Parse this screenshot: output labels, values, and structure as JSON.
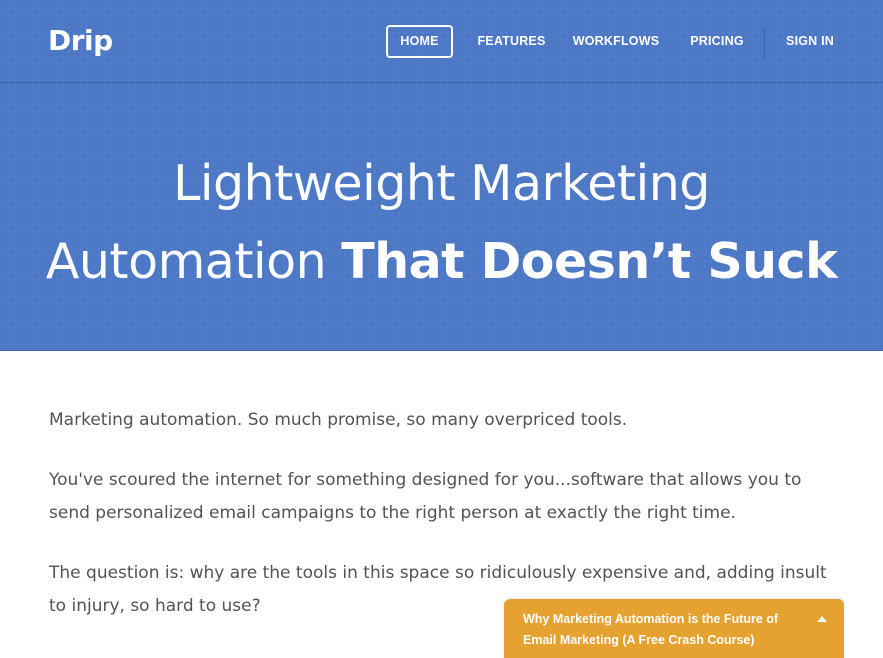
{
  "brand": {
    "logo": "Drip",
    "primary_color": "#4c78c6",
    "accent_color": "#e6a231"
  },
  "nav": {
    "items": [
      {
        "label": "HOME",
        "active": true
      },
      {
        "label": "FEATURES",
        "active": false
      },
      {
        "label": "WORKFLOWS",
        "active": false
      },
      {
        "label": "PRICING",
        "active": false
      },
      {
        "label": "SIGN IN",
        "active": false
      }
    ]
  },
  "hero": {
    "line1": "Lightweight Marketing",
    "line2_light": "Automation ",
    "line2_bold": "That Doesn’t Suck"
  },
  "body": {
    "paragraphs": [
      "Marketing automation. So much promise, so many overpriced tools.",
      "You've scoured the internet for something designed for you...software that allows you to send personalized email campaigns to the right person at exactly the right time.",
      "The question is: why are the tools in this space so ridiculously expensive and, adding insult to injury, so hard to use?"
    ]
  },
  "crash_course": {
    "title": "Why Marketing Automation is the Future of Email Marketing (A Free Crash Course)",
    "icon": "caret-up-icon"
  }
}
